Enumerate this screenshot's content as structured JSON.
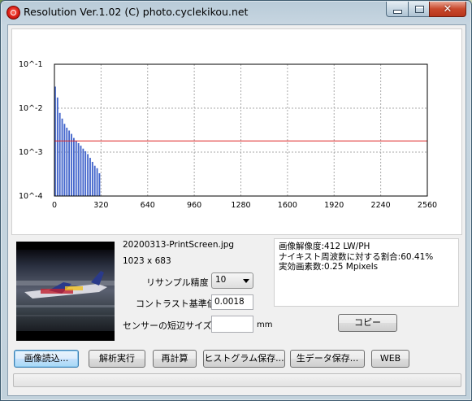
{
  "window": {
    "title": "Resolution Ver.1.02 (C) photo.cyclekikou.net"
  },
  "chart_data": {
    "type": "bar",
    "x": [
      8,
      24,
      40,
      56,
      72,
      88,
      104,
      120,
      136,
      152,
      168,
      184,
      200,
      216,
      232,
      248,
      264,
      280,
      296,
      312
    ],
    "values": [
      0.031,
      0.0175,
      0.0078,
      0.0058,
      0.0044,
      0.0036,
      0.0031,
      0.0026,
      0.0021,
      0.0018,
      0.0016,
      0.0014,
      0.0012,
      0.00105,
      0.0009,
      0.00074,
      0.0006,
      0.00049,
      0.00043,
      0.00033
    ],
    "xlim": [
      0,
      2560
    ],
    "ylim": [
      0.0001,
      0.1
    ],
    "yscale": "log",
    "x_ticks": [
      "0",
      "320",
      "640",
      "960",
      "1280",
      "1600",
      "1920",
      "2240",
      "2560"
    ],
    "y_ticks": [
      "10^-1",
      "10^-2",
      "10^-3",
      "10^-4"
    ],
    "threshold": 0.0018,
    "grid": true,
    "colors": {
      "bar": "#4466cc",
      "threshold": "#dd2222",
      "grid": "#aaaaaa"
    }
  },
  "image_info": {
    "file_name": "20200313-PrintScreen.jpg",
    "dimensions": "1023 x 683"
  },
  "settings": {
    "resample_label": "リサンプル精度",
    "resample_value": "10",
    "contrast_label": "コントラスト基準値",
    "contrast_value": "0.0018",
    "sensor_label": "センサーの短辺サイズ",
    "sensor_value": "",
    "sensor_unit": "mm"
  },
  "results": {
    "line1": "画像解像度:412 LW/PH",
    "line2": "ナイキスト周波数に対する割合:60.41%",
    "line3": "実効画素数:0.25 Mpixels"
  },
  "buttons": {
    "copy": "コピー",
    "load": "画像読込...",
    "analyze": "解析実行",
    "recalc": "再計算",
    "save_hist": "ヒストグラム保存...",
    "save_raw": "生データ保存...",
    "web": "WEB"
  },
  "progress": {
    "value": 0
  }
}
